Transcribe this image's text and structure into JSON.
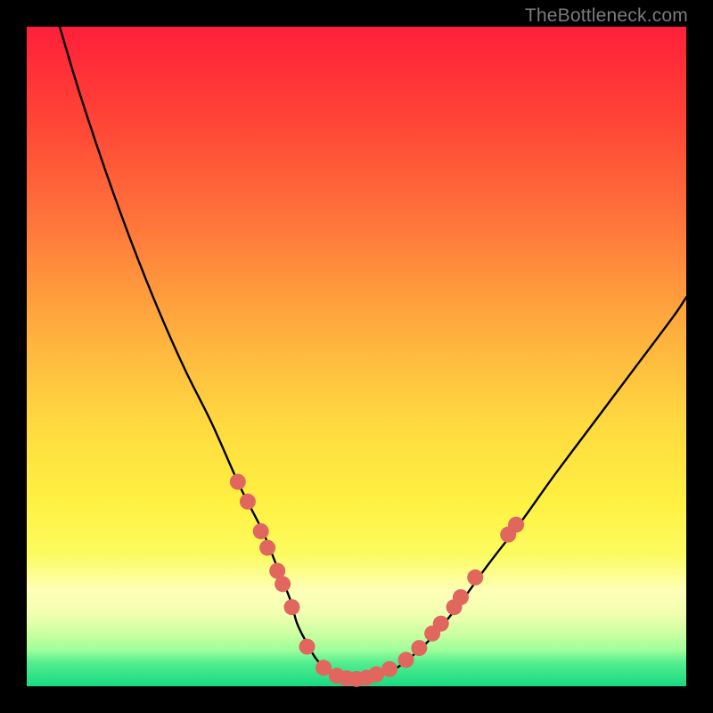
{
  "watermark": "TheBottleneck.com",
  "colors": {
    "black": "#000000",
    "curve": "#000000",
    "marker_fill": "#e1675e",
    "marker_stroke": "#cc564d"
  },
  "gradient_stops": [
    {
      "offset": 0.0,
      "color": "#ff1f3a"
    },
    {
      "offset": 0.14,
      "color": "#ff4436"
    },
    {
      "offset": 0.3,
      "color": "#ff763b"
    },
    {
      "offset": 0.45,
      "color": "#ffab3e"
    },
    {
      "offset": 0.6,
      "color": "#ffd940"
    },
    {
      "offset": 0.72,
      "color": "#fff141"
    },
    {
      "offset": 0.8,
      "color": "#fbfb60"
    },
    {
      "offset": 0.855,
      "color": "#ffffb8"
    },
    {
      "offset": 0.89,
      "color": "#f1ffb0"
    },
    {
      "offset": 0.92,
      "color": "#ccffa1"
    },
    {
      "offset": 0.945,
      "color": "#9eff9b"
    },
    {
      "offset": 0.965,
      "color": "#52ed8e"
    },
    {
      "offset": 1.0,
      "color": "#18d981"
    }
  ],
  "chart_data": {
    "type": "line",
    "title": "",
    "xlabel": "",
    "ylabel": "",
    "xlim": [
      0,
      100
    ],
    "ylim": [
      0,
      100
    ],
    "axes_visible": false,
    "grid": false,
    "series": [
      {
        "name": "bottleneck-curve",
        "x": [
          5,
          8,
          12,
          16,
          20,
          24,
          28,
          32,
          34,
          36,
          38,
          40,
          41,
          42.5,
          44,
          46,
          48,
          50,
          52,
          55,
          58,
          62,
          66,
          70,
          75,
          80,
          86,
          92,
          98,
          100
        ],
        "y": [
          100,
          90,
          78,
          67,
          57,
          48,
          40,
          31,
          27,
          23,
          18,
          13,
          9.5,
          6.5,
          4,
          2.2,
          1.2,
          1,
          1.2,
          2.2,
          4.2,
          8,
          13,
          18.5,
          25,
          32,
          40,
          48,
          56,
          59
        ],
        "note": "y-values estimated from pixel positions; curve is a V-shaped bottleneck dip reaching min ≈1% around x≈49."
      }
    ],
    "markers": {
      "name": "highlighted-points",
      "note": "salmon circular markers clustered along the lower portion of both curve arms",
      "points": [
        {
          "x": 32.0,
          "y": 31.0
        },
        {
          "x": 33.5,
          "y": 28.0
        },
        {
          "x": 35.5,
          "y": 23.5
        },
        {
          "x": 36.5,
          "y": 21.0
        },
        {
          "x": 38.0,
          "y": 17.5
        },
        {
          "x": 38.8,
          "y": 15.5
        },
        {
          "x": 40.2,
          "y": 12.0
        },
        {
          "x": 42.5,
          "y": 6.0
        },
        {
          "x": 45.0,
          "y": 2.8
        },
        {
          "x": 47.0,
          "y": 1.6
        },
        {
          "x": 48.5,
          "y": 1.2
        },
        {
          "x": 50.0,
          "y": 1.1
        },
        {
          "x": 51.5,
          "y": 1.3
        },
        {
          "x": 53.0,
          "y": 1.8
        },
        {
          "x": 55.0,
          "y": 2.6
        },
        {
          "x": 57.5,
          "y": 4.0
        },
        {
          "x": 59.5,
          "y": 5.8
        },
        {
          "x": 61.5,
          "y": 8.0
        },
        {
          "x": 62.8,
          "y": 9.5
        },
        {
          "x": 64.8,
          "y": 12.0
        },
        {
          "x": 65.8,
          "y": 13.5
        },
        {
          "x": 68.0,
          "y": 16.5
        },
        {
          "x": 73.0,
          "y": 23.0
        },
        {
          "x": 74.2,
          "y": 24.5
        }
      ]
    }
  }
}
